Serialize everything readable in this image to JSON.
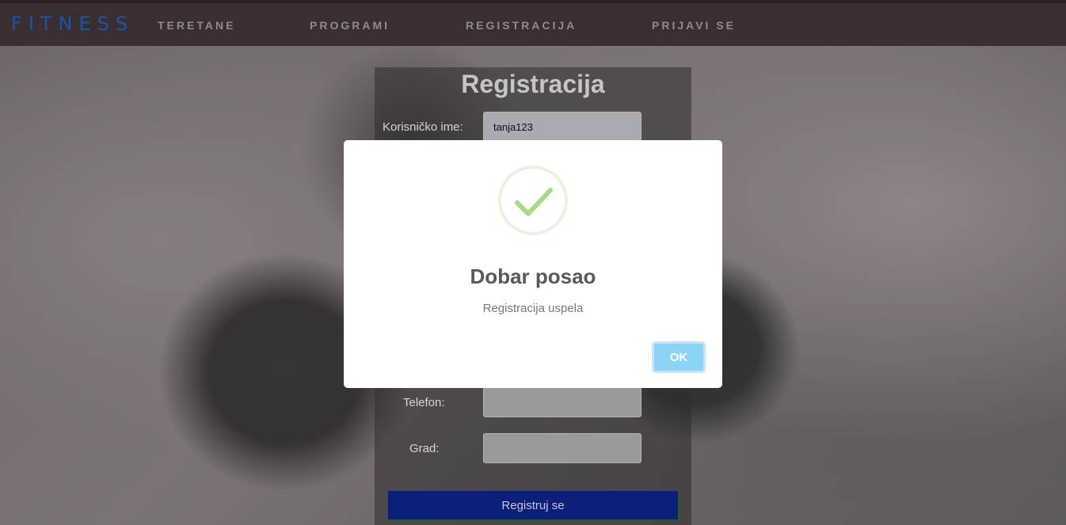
{
  "nav": {
    "brand": "FITNESS",
    "links": [
      "TERETANE",
      "PROGRAMI",
      "REGISTRACIJA",
      "PRIJAVI SE"
    ]
  },
  "form": {
    "title": "Registracija",
    "fields": [
      {
        "label": "Korisničko ime:",
        "value": "tanja123"
      },
      {
        "label": "Telefon:",
        "value": ""
      },
      {
        "label": "Grad:",
        "value": ""
      }
    ],
    "submit_label": "Registruj se"
  },
  "modal": {
    "icon": "checkmark-icon",
    "title": "Dobar posao",
    "text": "Registracija uspela",
    "ok_label": "OK"
  },
  "colors": {
    "nav_bg": "#3a2e33",
    "brand": "#1e54a8",
    "submit_bg": "#0c1f78",
    "ok_bg": "#8cd4f5",
    "check": "#a5dc86"
  }
}
